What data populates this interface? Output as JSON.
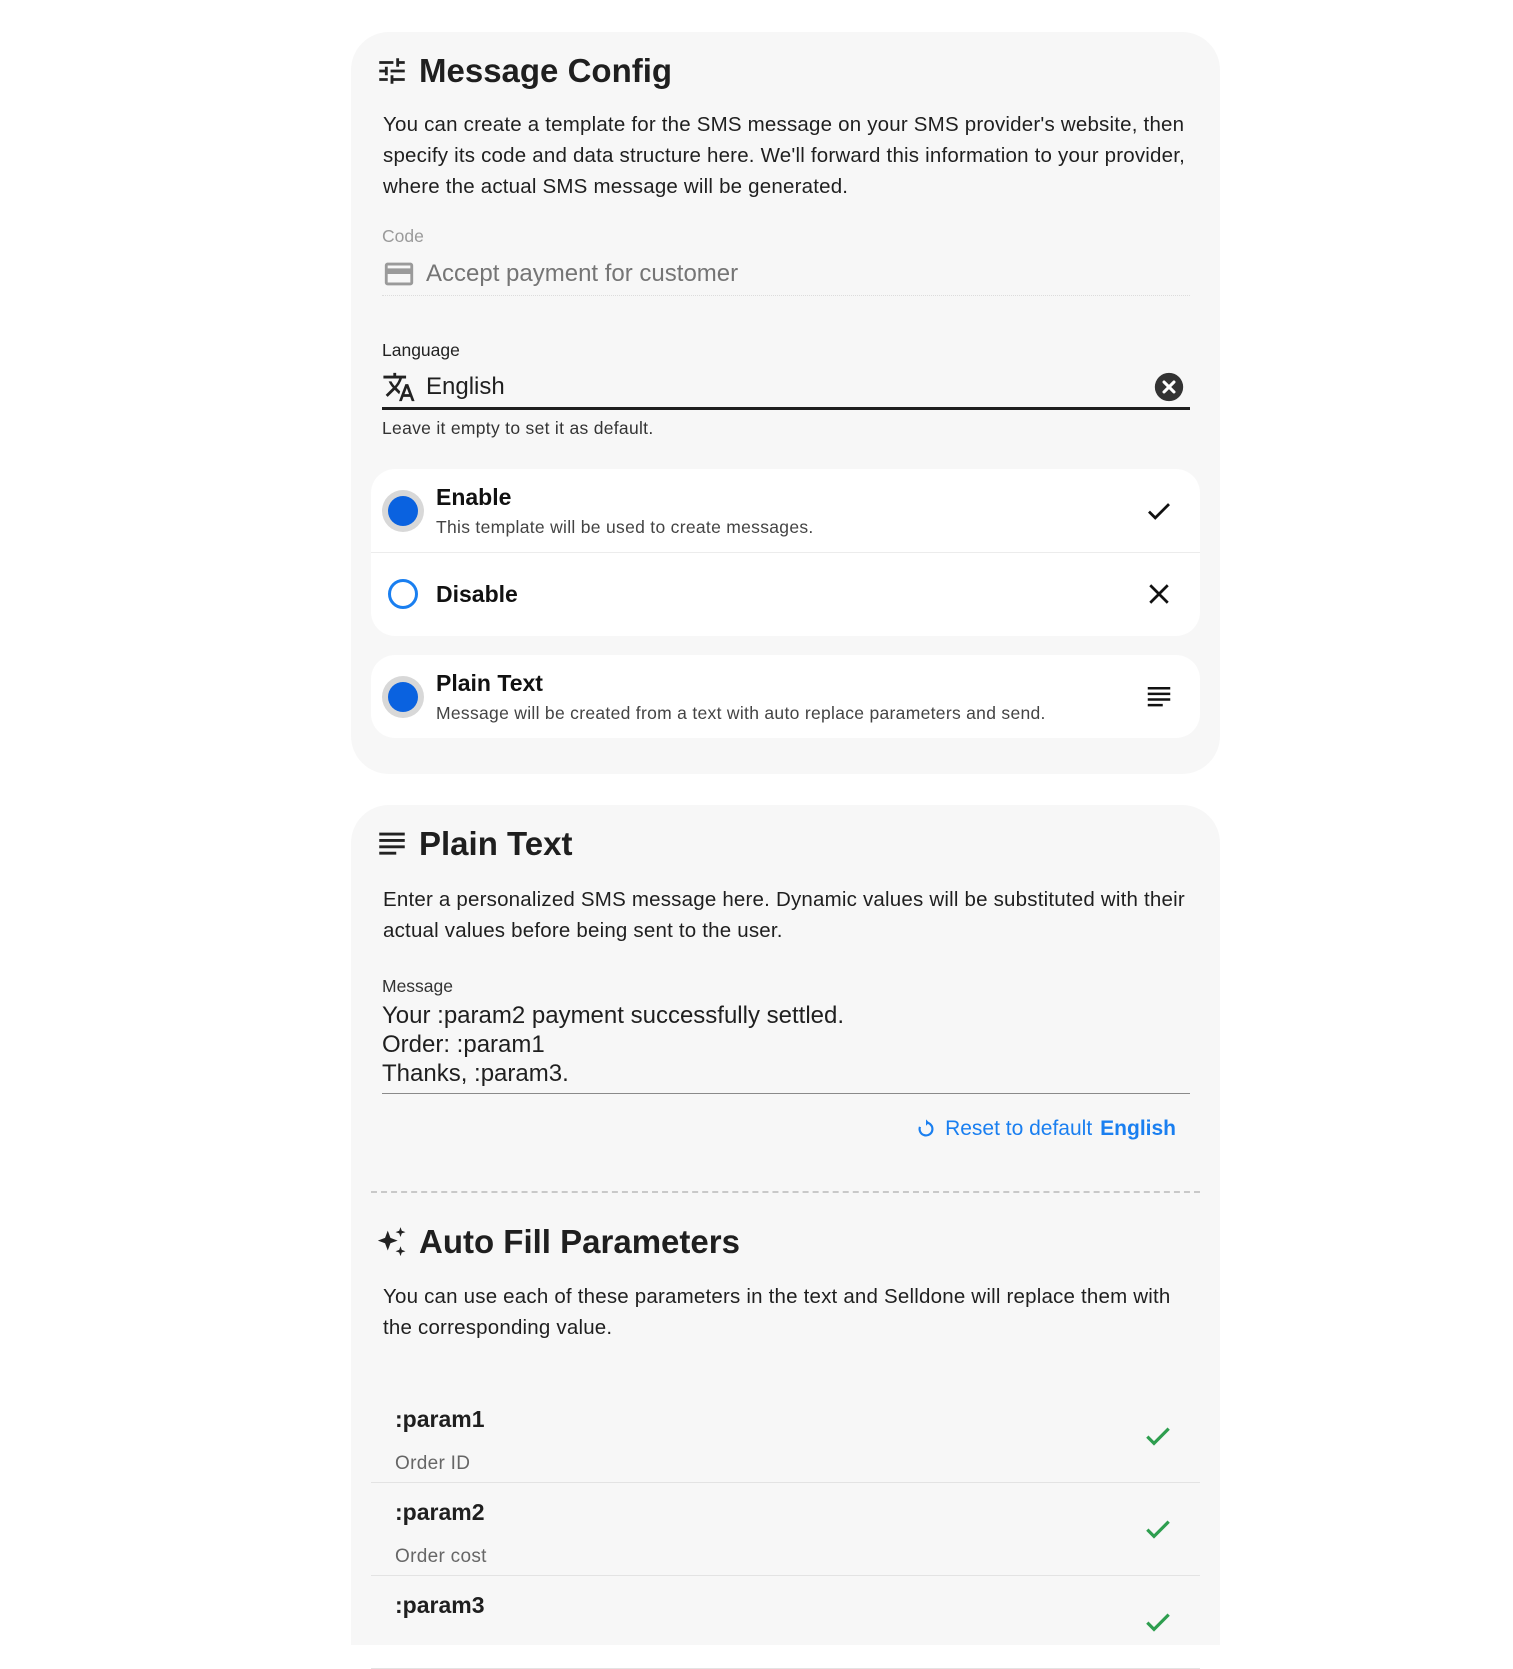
{
  "message_config": {
    "title": "Message Config",
    "description": "You can create a template for the SMS message on your SMS provider's website, then specify its code and data structure here. We'll forward this information to your provider, where the actual SMS message will be generated.",
    "code": {
      "label": "Code",
      "placeholder": "Accept payment for customer",
      "value": ""
    },
    "language": {
      "label": "Language",
      "value": "English",
      "hint": "Leave it empty to set it as default."
    },
    "status_options": [
      {
        "title": "Enable",
        "subtitle": "This template will be used to create messages.",
        "selected": true,
        "icon": "check-icon"
      },
      {
        "title": "Disable",
        "subtitle": "",
        "selected": false,
        "icon": "close-icon"
      }
    ],
    "type_option": {
      "title": "Plain Text",
      "subtitle": "Message will be created from a text with auto replace parameters and send.",
      "selected": true,
      "icon": "text-lines-icon"
    }
  },
  "plain_text": {
    "title": "Plain Text",
    "description": "Enter a personalized SMS message here. Dynamic values will be substituted with their actual values before being sent to the user.",
    "message": {
      "label": "Message",
      "lines": [
        "Your :param2 payment successfully settled.",
        "Order: :param1",
        "Thanks, :param3."
      ]
    },
    "reset": {
      "label": "Reset to default",
      "language": "English"
    }
  },
  "auto_fill": {
    "title": "Auto Fill Parameters",
    "description": "You can use each of these parameters in the text and Selldone will replace them with the corresponding value.",
    "params": [
      {
        "name": ":param1",
        "desc": "Order ID"
      },
      {
        "name": ":param2",
        "desc": "Order cost"
      },
      {
        "name": ":param3",
        "desc": ""
      }
    ]
  },
  "colors": {
    "accent": "#1a7ff0",
    "radio": "#0a62e0",
    "check": "#2e9e4f",
    "card_bg": "#f7f7f7"
  }
}
